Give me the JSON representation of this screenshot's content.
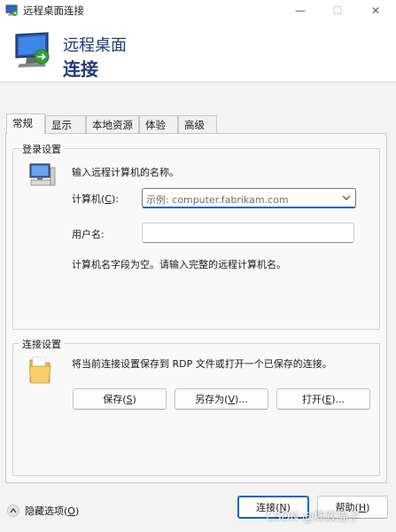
{
  "window": {
    "title": "远程桌面连接",
    "min_glyph": "—",
    "max_glyph": "☐",
    "close_glyph": "✕"
  },
  "header": {
    "line1": "远程桌面",
    "line2": "连接"
  },
  "tabs": [
    {
      "label": "常规",
      "active": true
    },
    {
      "label": "显示"
    },
    {
      "label": "本地资源"
    },
    {
      "label": "体验"
    },
    {
      "label": "高级"
    }
  ],
  "login": {
    "group_title": "登录设置",
    "intro": "输入远程计算机的名称。",
    "computer_label_pre": "计算机(",
    "computer_label_key": "C",
    "computer_label_post": "):",
    "computer_placeholder": "示例: computer.fabrikam.com",
    "username_label": "用户名:",
    "username_value": "",
    "hint": "计算机名字段为空。请输入完整的远程计算机名。"
  },
  "connection": {
    "group_title": "连接设置",
    "description": "将当前连接设置保存到 RDP 文件或打开一个已保存的连接。",
    "save_pre": "保存(",
    "save_key": "S",
    "save_post": ")",
    "saveas_pre": "另存为(",
    "saveas_key": "V",
    "saveas_post": ")...",
    "open_pre": "打开(",
    "open_key": "E",
    "open_post": ")..."
  },
  "footer": {
    "options_pre": "隐藏选项(",
    "options_key": "O",
    "options_post": ")",
    "connect_pre": "连接(",
    "connect_key": "N",
    "connect_post": ")",
    "help_pre": "帮助(",
    "help_key": "H",
    "help_post": ")"
  },
  "watermark": "CSDN @摔跤猫子",
  "icons": {
    "app": "remote-desktop-icon",
    "computer": "computer-icon",
    "folder": "folder-icon",
    "options_toggle": "chevron-up-icon"
  },
  "colors": {
    "header_text": "#1f3a7a",
    "accent": "#0067c0"
  }
}
